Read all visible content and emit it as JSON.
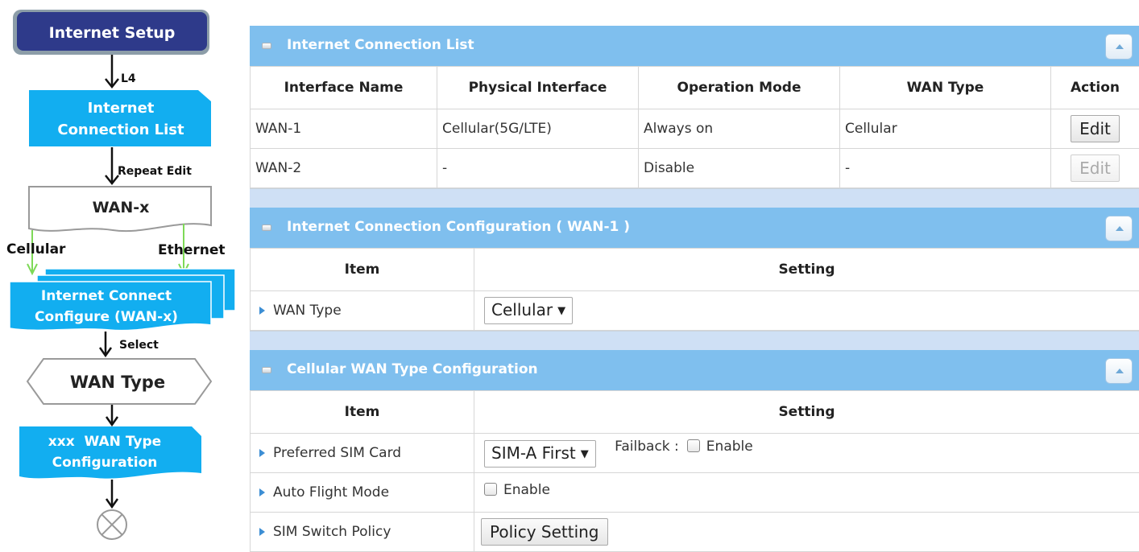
{
  "flowchart": {
    "start": "Internet Setup",
    "arrow1_label": "L4",
    "box1": [
      "Internet",
      "Connection List"
    ],
    "arrow2_label": "Repeat Edit",
    "box2": "WAN-x",
    "branch_left": "Cellular",
    "branch_right": "Ethernet",
    "box3": [
      "Internet Connect",
      "Configure (WAN-x)"
    ],
    "arrow3_label": "Select",
    "box4": "WAN Type",
    "box5": [
      "xxx  WAN Type",
      "Configuration"
    ]
  },
  "connection_list": {
    "title": "Internet Connection List",
    "columns": [
      "Interface Name",
      "Physical Interface",
      "Operation Mode",
      "WAN Type",
      "Action"
    ],
    "rows": [
      {
        "name": "WAN-1",
        "physical": "Cellular(5G/LTE)",
        "mode": "Always on",
        "wan_type": "Cellular",
        "action": "Edit"
      },
      {
        "name": "WAN-2",
        "physical": "-",
        "mode": "Disable",
        "wan_type": "-",
        "action": "Edit"
      }
    ]
  },
  "connection_config": {
    "title": "Internet Connection Configuration ( WAN-1 )",
    "col_item": "Item",
    "col_setting": "Setting",
    "wan_type_label": "WAN Type",
    "wan_type_value": "Cellular"
  },
  "cellular_config": {
    "title": "Cellular WAN Type Configuration",
    "col_item": "Item",
    "col_setting": "Setting",
    "preferred_sim_label": "Preferred SIM Card",
    "preferred_sim_value": "SIM-A First",
    "failback_label": "Failback :",
    "failback_enable": "Enable",
    "auto_flight_label": "Auto Flight Mode",
    "auto_flight_enable": "Enable",
    "sim_switch_label": "SIM Switch Policy",
    "sim_switch_button": "Policy Setting"
  },
  "colors": {
    "header_blue": "#7fbfee",
    "flow_cyan": "#12aef0",
    "flow_dark": "#2e3a8a",
    "separator": "#cfe0f5"
  }
}
